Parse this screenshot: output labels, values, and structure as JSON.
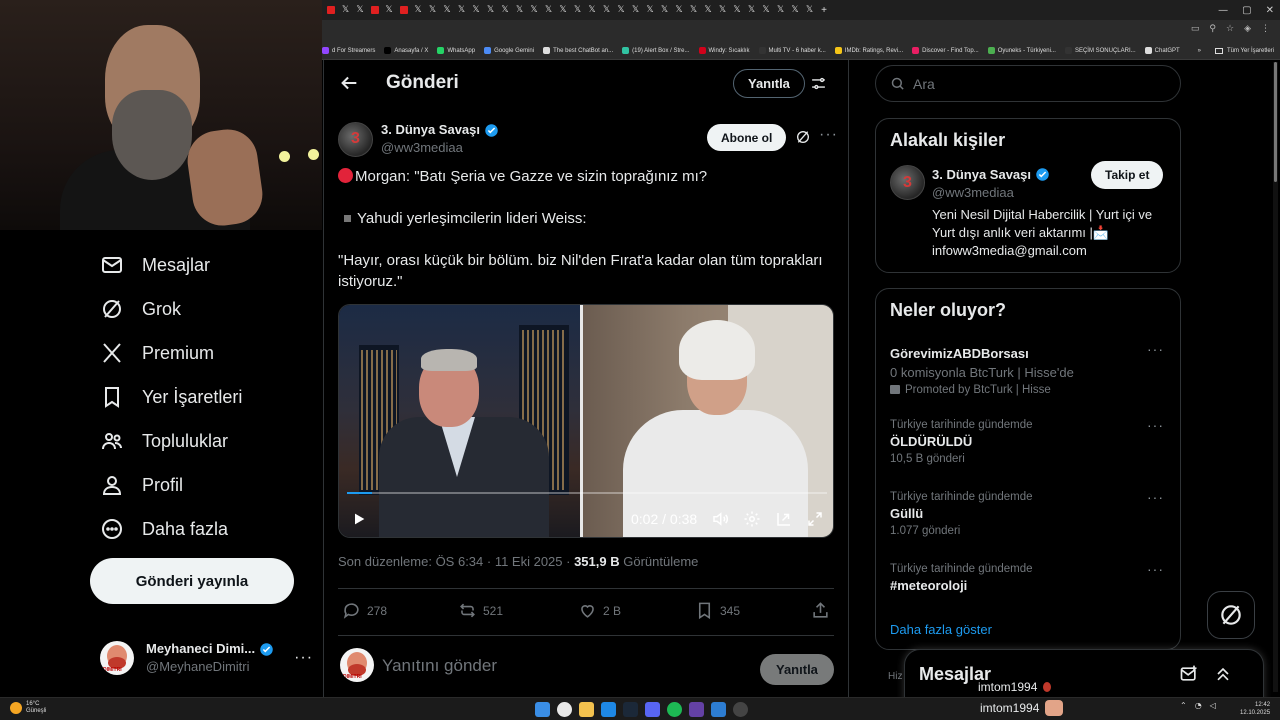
{
  "browser": {
    "tab_count": 34,
    "bookmarks": [
      {
        "label": "d For Streamers",
        "color": "#9146ff"
      },
      {
        "label": "Anasayfa / X",
        "color": "#000000"
      },
      {
        "label": "WhatsApp",
        "color": "#25d366"
      },
      {
        "label": "Google Gemini",
        "color": "#4c8bf5"
      },
      {
        "label": "The best ChatBot an...",
        "color": "#dddddd"
      },
      {
        "label": "(19) Alert Box / Stre...",
        "color": "#31c3a2"
      },
      {
        "label": "Windy: Sıcaklık",
        "color": "#d0021b"
      },
      {
        "label": "Multi TV - 6 haber k...",
        "color": "#333333"
      },
      {
        "label": "IMDb: Ratings, Revi...",
        "color": "#f5c518"
      },
      {
        "label": "Discover - Find Top...",
        "color": "#e91e63"
      },
      {
        "label": "Oyuneks - Türkiyeni...",
        "color": "#4caf50"
      },
      {
        "label": "SEÇİM SONUÇLARI...",
        "color": "#333333"
      },
      {
        "label": "ChatGPT",
        "color": "#dddddd"
      }
    ],
    "all_bookmarks": "Tüm Yer İşaretleri"
  },
  "nav": {
    "items": [
      {
        "label": "Mesajlar",
        "icon": "mail-icon"
      },
      {
        "label": "Grok",
        "icon": "grok-icon"
      },
      {
        "label": "Premium",
        "icon": "x-logo-icon"
      },
      {
        "label": "Yer İşaretleri",
        "icon": "bookmark-icon"
      },
      {
        "label": "Topluluklar",
        "icon": "communities-icon"
      },
      {
        "label": "Profil",
        "icon": "profile-icon"
      },
      {
        "label": "Daha fazla",
        "icon": "more-circle-icon"
      }
    ],
    "post_button": "Gönderi yayınla"
  },
  "account": {
    "name": "Meyhaneci Dimi...",
    "handle": "@MeyhaneDimitri",
    "avatar_text": "DIMITRI"
  },
  "header": {
    "title": "Gönderi",
    "reply_button": "Yanıtla"
  },
  "tweet": {
    "author_name": "3. Dünya Savaşı",
    "author_handle": "@ww3mediaa",
    "avatar_text": "3",
    "follow_button": "Abone ol",
    "line1": "Morgan: \"Batı Şeria ve Gazze ve sizin toprağınız mı?",
    "line2": "Yahudi yerleşimcilerin lideri Weiss:",
    "line3": "\"Hayır, orası küçük bir bölüm. biz Nil'den Fırat'a kadar olan tüm toprakları istiyoruz.\"",
    "video": {
      "time": "0:02 / 0:38",
      "progress": 0.053
    },
    "meta_prefix": "Son düzenleme: ÖS 6:34 · 11 Eki 2025 · ",
    "views_count": "351,9 B",
    "views_label": " Görüntüleme",
    "stats": {
      "replies": "278",
      "reposts": "521",
      "likes": "2 B",
      "bookmarks": "345"
    }
  },
  "reply": {
    "placeholder": "Yanıtını gönder",
    "button": "Yanıtla"
  },
  "search": {
    "placeholder": "Ara"
  },
  "related": {
    "title": "Alakalı kişiler",
    "name": "3. Dünya Savaşı",
    "handle": "@ww3mediaa",
    "follow_button": "Takip et",
    "bio": "Yeni Nesil Dijital Habercilik | Yurt içi ve Yurt dışı anlık veri aktarımı |📩 infoww3media@gmail.com"
  },
  "trends": {
    "title": "Neler oluyor?",
    "items": [
      {
        "context": "",
        "title": "GörevimizABDBorsası",
        "desc": "0 komisyonla BtcTurk | Hisse'de",
        "sub": "Promoted by BtcTurk | Hisse"
      },
      {
        "context": "Türkiye tarihinde gündemde",
        "title": "ÖLDÜRÜLDÜ",
        "desc": "",
        "sub": "10,5 B gönderi"
      },
      {
        "context": "Türkiye tarihinde gündemde",
        "title": "Güllü",
        "desc": "",
        "sub": "1.077 gönderi"
      },
      {
        "context": "Türkiye tarihinde gündemde",
        "title": "#meteoroloji",
        "desc": "",
        "sub": ""
      }
    ],
    "show_more": "Daha fazla göster"
  },
  "messages": {
    "title": "Mesajlar",
    "peek_user": "imtom1994",
    "hint": "Hiz"
  },
  "taskbar": {
    "temp": "16°C",
    "weather": "Güneşli",
    "time": "12:42",
    "date": "12.10.2025",
    "bottom_user": "imtom1994"
  }
}
